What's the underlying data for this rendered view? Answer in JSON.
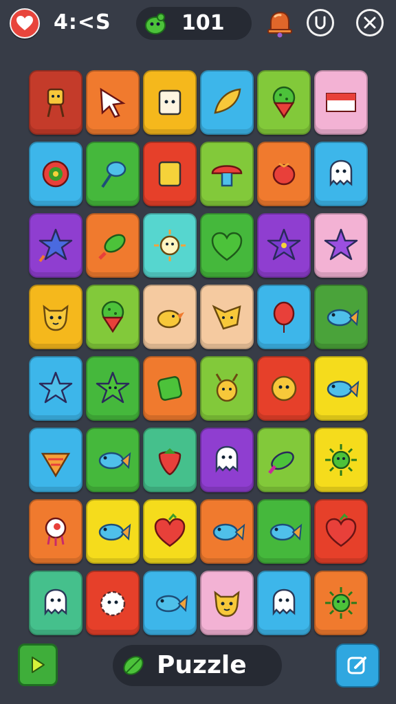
{
  "header": {
    "timer": "4:<S",
    "score": "101",
    "icons": {
      "lives": "heart-icon",
      "coin": "green-blob-coin-icon",
      "bell": "bell-icon",
      "shield": "shield-icon",
      "close": "close-icon"
    }
  },
  "board": {
    "columns": 6,
    "rows": 8,
    "tiles": [
      {
        "bg": "#c43b2a",
        "icon": "totem-icon"
      },
      {
        "bg": "#f07a2e",
        "icon": "arrow-cursor-icon"
      },
      {
        "bg": "#f5b81c",
        "icon": "bag-face-icon"
      },
      {
        "bg": "#3db6ea",
        "icon": "leaf-pen-icon"
      },
      {
        "bg": "#82c93a",
        "icon": "ice-cream-icon"
      },
      {
        "bg": "#f3b2d4",
        "icon": "flag-icon"
      },
      {
        "bg": "#3db6ea",
        "icon": "target-icon"
      },
      {
        "bg": "#45b83c",
        "icon": "racket-fish-icon"
      },
      {
        "bg": "#e6402a",
        "icon": "gold-bar-icon"
      },
      {
        "bg": "#82c93a",
        "icon": "mushroom-icon"
      },
      {
        "bg": "#f07a2e",
        "icon": "red-pepper-icon"
      },
      {
        "bg": "#3db6ea",
        "icon": "ghost-icon"
      },
      {
        "bg": "#8f3ed0",
        "icon": "star-rocket-icon"
      },
      {
        "bg": "#f07a2e",
        "icon": "rocket-fish-icon"
      },
      {
        "bg": "#56d6cf",
        "icon": "sun-face-icon"
      },
      {
        "bg": "#45b83c",
        "icon": "green-heart-icon"
      },
      {
        "bg": "#8f3ed0",
        "icon": "star-burst-icon"
      },
      {
        "bg": "#f3b2d4",
        "icon": "purple-star-icon"
      },
      {
        "bg": "#f5b81c",
        "icon": "cat-face-icon"
      },
      {
        "bg": "#82c93a",
        "icon": "ice-cream-icon"
      },
      {
        "bg": "#f5caa0",
        "icon": "bird-icon"
      },
      {
        "bg": "#f5caa0",
        "icon": "fox-icon"
      },
      {
        "bg": "#3db6ea",
        "icon": "red-balloon-icon"
      },
      {
        "bg": "#4aa33a",
        "icon": "blue-fish-icon"
      },
      {
        "bg": "#3db6ea",
        "icon": "blue-star-icon"
      },
      {
        "bg": "#45b83c",
        "icon": "green-star-icon"
      },
      {
        "bg": "#f07a2e",
        "icon": "green-box-icon"
      },
      {
        "bg": "#82c93a",
        "icon": "bug-face-icon"
      },
      {
        "bg": "#e6402a",
        "icon": "flower-face-icon"
      },
      {
        "bg": "#f5dc1c",
        "icon": "blue-fish-icon"
      },
      {
        "bg": "#3db6ea",
        "icon": "shell-icon"
      },
      {
        "bg": "#45b83c",
        "icon": "blue-fish-icon"
      },
      {
        "bg": "#45c08c",
        "icon": "strawberry-icon"
      },
      {
        "bg": "#8f3ed0",
        "icon": "ghost-icon"
      },
      {
        "bg": "#82c93a",
        "icon": "rainbow-fish-icon"
      },
      {
        "bg": "#f5dc1c",
        "icon": "green-sun-icon"
      },
      {
        "bg": "#f07a2e",
        "icon": "octopus-icon"
      },
      {
        "bg": "#f5dc1c",
        "icon": "blue-fish-icon"
      },
      {
        "bg": "#f5dc1c",
        "icon": "red-heart-icon"
      },
      {
        "bg": "#f07a2e",
        "icon": "blue-fish-icon"
      },
      {
        "bg": "#45b83c",
        "icon": "blue-fish-icon"
      },
      {
        "bg": "#e6402a",
        "icon": "red-heart-icon"
      },
      {
        "bg": "#45c08c",
        "icon": "ghost-icon"
      },
      {
        "bg": "#e6402a",
        "icon": "white-fluff-icon"
      },
      {
        "bg": "#3db6ea",
        "icon": "blue-fish-icon"
      },
      {
        "bg": "#f3b2d4",
        "icon": "cat-face-icon"
      },
      {
        "bg": "#3db6ea",
        "icon": "ghost-icon"
      },
      {
        "bg": "#f07a2e",
        "icon": "green-sun-icon"
      }
    ]
  },
  "footer": {
    "mode_label": "Puzzle",
    "icons": {
      "play": "play-icon",
      "mode": "leaf-icon",
      "edit": "edit-icon"
    }
  }
}
